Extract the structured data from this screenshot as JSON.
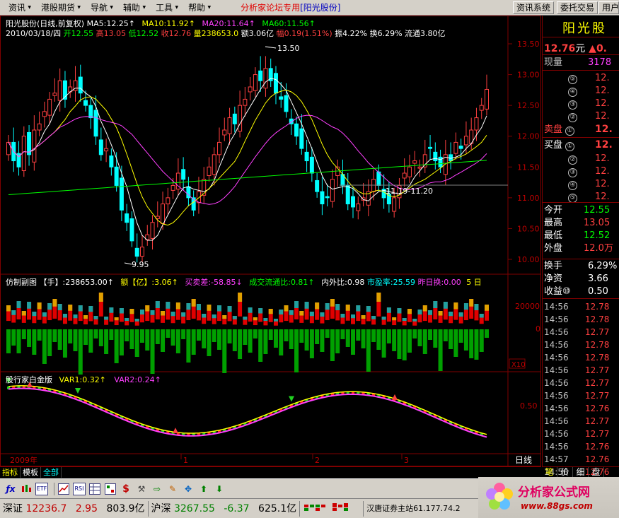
{
  "menu": {
    "items": [
      "资讯",
      "港股期货",
      "导航",
      "辅助",
      "工具",
      "帮助"
    ],
    "title_prefix": "分析家论坛专用",
    "title_stock": "[阳光股份]",
    "btn_info": "资讯系统",
    "btn_order": "委托交易",
    "btn_use": "用户"
  },
  "header": {
    "line1": {
      "name": "阳光股份(日线,前复权)",
      "ma5": "MA5:12.25↑",
      "ma10": "MA10:11.92↑",
      "ma20": "MA20:11.64↑",
      "ma60": "MA60:11.56↑"
    },
    "line2": {
      "date": "2010/03/18/四",
      "open": "开12.55",
      "high": "高13.05",
      "low": "低12.52",
      "close": "收12.76",
      "vol": "量238653.0",
      "amount": "额3.06亿",
      "change": "幅0.19(1.51%)",
      "amp": "振4.22%",
      "turnover": "换6.29%",
      "float": "流通3.80亿"
    }
  },
  "price_axis": [
    "13.50",
    "13.00",
    "12.50",
    "12.00",
    "11.50",
    "11.00",
    "10.50",
    "10.00"
  ],
  "annotations": {
    "high_mark": "13.50",
    "low_mark": "9.95",
    "range_mark": "11.19-11.20"
  },
  "volume_panel": {
    "title": "仿制副图",
    "hand": "【手】:238653.00↑",
    "amount": "额【亿】:3.06↑",
    "diff": "买卖差:-58.85↓",
    "ratio": "成交流通比:0.81↑",
    "inout": "内外比:0.98",
    "pe": "市盈率:25.59",
    "prev_turn": "昨日换:0.00",
    "days": "5 日",
    "axis_top": "20000",
    "axis_zero": "0",
    "axis_unit": "X10"
  },
  "indicator_panel": {
    "title": "股行家白金版",
    "var1": "VAR1:0.32↑",
    "var2": "VAR2:0.24↑",
    "axis_mid": "0.50"
  },
  "time_axis": {
    "year": "2009年",
    "m1": "1",
    "m2": "2",
    "m3": "3",
    "label": "日线"
  },
  "right": {
    "stock_name": "阳光股",
    "price": "12.76",
    "price_unit": "元",
    "price_chg": "▲0.",
    "now_vol_label": "现量",
    "now_vol": "3178",
    "sell_rows": [
      {
        "n": "⑤",
        "p": "12."
      },
      {
        "n": "④",
        "p": "12."
      },
      {
        "n": "③",
        "p": "12."
      },
      {
        "n": "②",
        "p": "12."
      }
    ],
    "sell1_label": "卖盘",
    "sell1_n": "①",
    "sell1_p": "12.",
    "buy1_label": "买盘",
    "buy1_n": "①",
    "buy1_p": "12.",
    "buy_rows": [
      {
        "n": "②",
        "p": "12."
      },
      {
        "n": "③",
        "p": "12."
      },
      {
        "n": "④",
        "p": "12."
      },
      {
        "n": "⑤",
        "p": "12."
      }
    ],
    "stats": [
      {
        "label": "今开",
        "val": "12.55",
        "color": "#00ff00"
      },
      {
        "label": "最高",
        "val": "13.05",
        "color": "#ff4040"
      },
      {
        "label": "最低",
        "val": "12.52",
        "color": "#00ff00"
      },
      {
        "label": "外盘",
        "val": "12.0万",
        "color": "#ff4040"
      }
    ],
    "stats2": [
      {
        "label": "换手",
        "val": "6.29%",
        "color": "#ffffff"
      },
      {
        "label": "净资",
        "val": "3.66",
        "color": "#ffffff"
      },
      {
        "label": "收益⑩",
        "val": "0.50",
        "color": "#ffffff"
      }
    ],
    "ticks": [
      {
        "t": "14:56",
        "p": "12.78"
      },
      {
        "t": "14:56",
        "p": "12.78"
      },
      {
        "t": "14:56",
        "p": "12.77"
      },
      {
        "t": "14:56",
        "p": "12.78"
      },
      {
        "t": "14:56",
        "p": "12.78"
      },
      {
        "t": "14:56",
        "p": "12.77"
      },
      {
        "t": "14:56",
        "p": "12.77"
      },
      {
        "t": "14:56",
        "p": "12.77"
      },
      {
        "t": "14:56",
        "p": "12.76"
      },
      {
        "t": "14:56",
        "p": "12.77"
      },
      {
        "t": "14:56",
        "p": "12.77"
      },
      {
        "t": "14:56",
        "p": "12.76"
      },
      {
        "t": "14:57",
        "p": "12.76"
      },
      {
        "t": "14:56",
        "p": "12.76"
      }
    ]
  },
  "tabs": {
    "left": [
      "指标",
      "模板",
      "全部"
    ],
    "right": [
      "笔",
      "价",
      "细",
      "盘"
    ]
  },
  "statusbar": {
    "sz_label": "深证",
    "sz_val": "12236.7",
    "sz_chg": "2.95",
    "sz_amt": "803.9亿",
    "hs_label": "沪深",
    "hs_val": "3267.55",
    "hs_chg": "-6.37",
    "hs_amt": "625.1亿",
    "server": "汉唐证券主站61.177.74.2"
  },
  "logo": {
    "text": "分析家公式网",
    "url": "www.88gs.com"
  },
  "colors": {
    "up": "#ff4040",
    "down": "#00ffff",
    "ma5": "#ffffff",
    "ma10": "#ffff00",
    "ma20": "#ff40ff",
    "ma60": "#00ff00"
  }
}
